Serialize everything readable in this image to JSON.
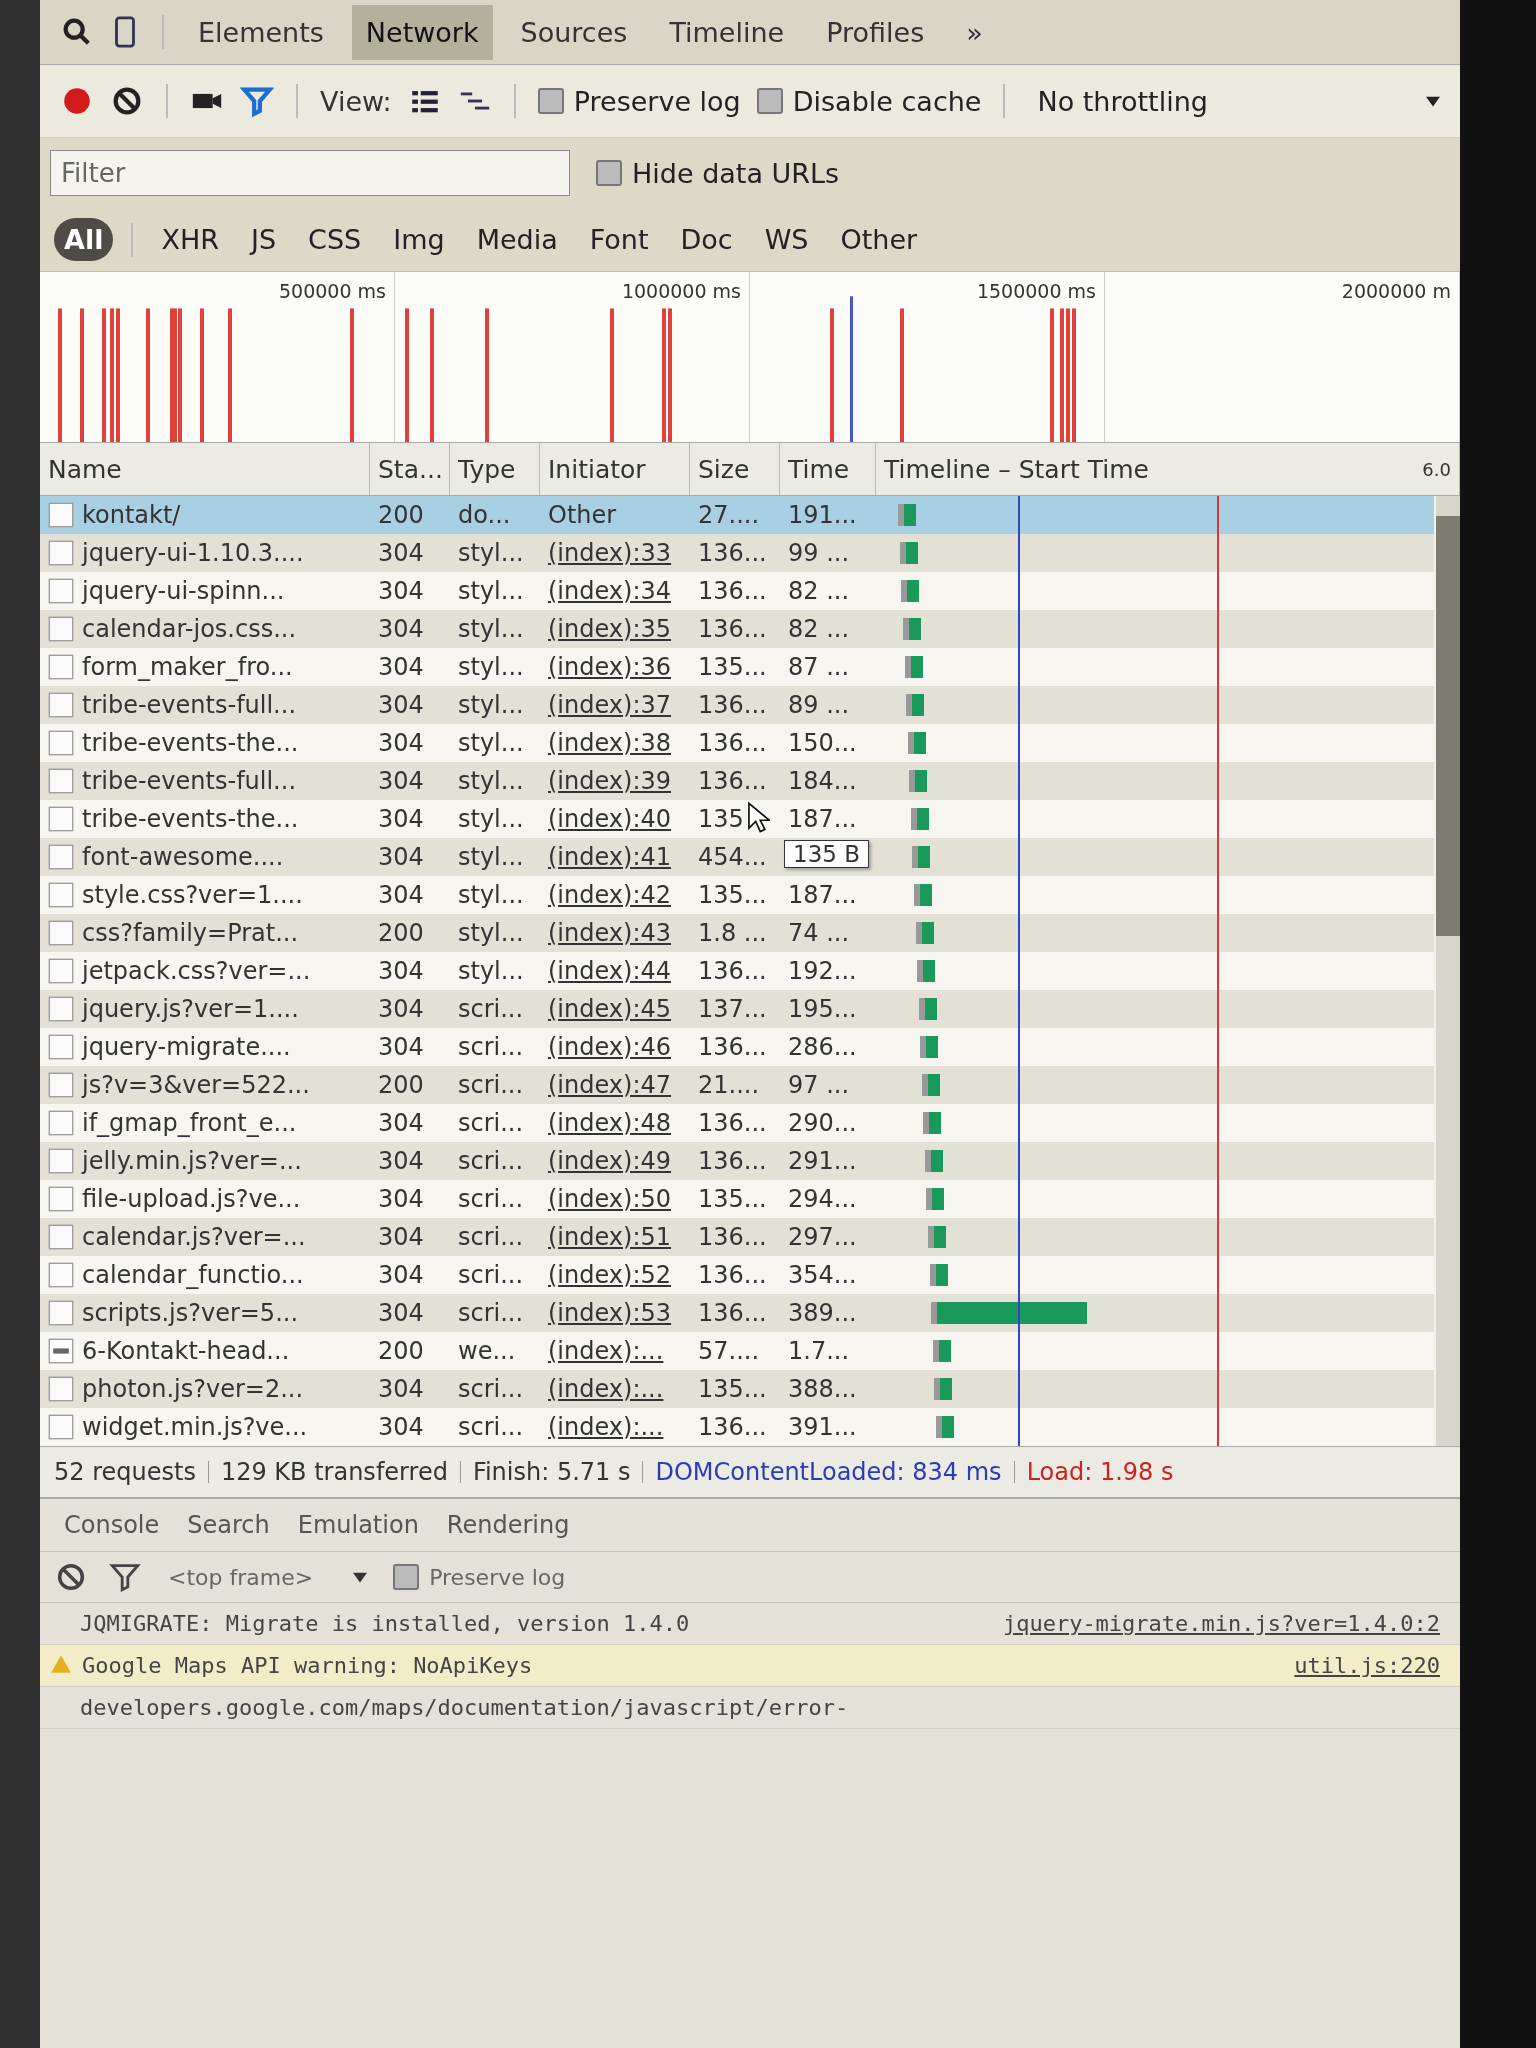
{
  "panel_tabs": [
    {
      "label": "Elements",
      "selected": false
    },
    {
      "label": "Network",
      "selected": true
    },
    {
      "label": "Sources",
      "selected": false
    },
    {
      "label": "Timeline",
      "selected": false
    },
    {
      "label": "Profiles",
      "selected": false
    }
  ],
  "more_tabs": "»",
  "toolbar": {
    "recording": true,
    "filter_active": true,
    "view_label": "View:",
    "preserve_log": {
      "label": "Preserve log",
      "checked": false
    },
    "disable_cache": {
      "label": "Disable cache",
      "checked": false
    },
    "throttling": "No throttling"
  },
  "filter": {
    "placeholder": "Filter",
    "hide_data_urls": {
      "label": "Hide data URLs",
      "checked": false
    }
  },
  "type_filters": [
    {
      "label": "All",
      "selected": true
    },
    {
      "label": "XHR",
      "selected": false
    },
    {
      "label": "JS",
      "selected": false
    },
    {
      "label": "CSS",
      "selected": false
    },
    {
      "label": "Img",
      "selected": false
    },
    {
      "label": "Media",
      "selected": false
    },
    {
      "label": "Font",
      "selected": false
    },
    {
      "label": "Doc",
      "selected": false
    },
    {
      "label": "WS",
      "selected": false
    },
    {
      "label": "Other",
      "selected": false
    }
  ],
  "overview": {
    "ticks": [
      "500000 ms",
      "1000000 ms",
      "1500000 ms",
      "2000000 m"
    ]
  },
  "table": {
    "columns": [
      "Name",
      "Sta...",
      "Type",
      "Initiator",
      "Size",
      "Time",
      "Timeline – Start Time"
    ],
    "scale_label": "6.0",
    "rows": [
      {
        "name": "kontakt/",
        "status": "200",
        "type": "do...",
        "initiator": "Other",
        "linked": false,
        "size": "27....",
        "time": "191...",
        "selected": true,
        "thumbnail": false,
        "kind": "short"
      },
      {
        "name": "jquery-ui-1.10.3....",
        "status": "304",
        "type": "styl...",
        "initiator": "(index):33",
        "linked": true,
        "size": "136...",
        "time": "99 ...",
        "selected": false,
        "thumbnail": false,
        "kind": "short"
      },
      {
        "name": "jquery-ui-spinn...",
        "status": "304",
        "type": "styl...",
        "initiator": "(index):34",
        "linked": true,
        "size": "136...",
        "time": "82 ...",
        "selected": false,
        "thumbnail": false,
        "kind": "short"
      },
      {
        "name": "calendar-jos.css...",
        "status": "304",
        "type": "styl...",
        "initiator": "(index):35",
        "linked": true,
        "size": "136...",
        "time": "82 ...",
        "selected": false,
        "thumbnail": false,
        "kind": "short"
      },
      {
        "name": "form_maker_fro...",
        "status": "304",
        "type": "styl...",
        "initiator": "(index):36",
        "linked": true,
        "size": "135...",
        "time": "87 ...",
        "selected": false,
        "thumbnail": false,
        "kind": "short"
      },
      {
        "name": "tribe-events-full...",
        "status": "304",
        "type": "styl...",
        "initiator": "(index):37",
        "linked": true,
        "size": "136...",
        "time": "89 ...",
        "selected": false,
        "thumbnail": false,
        "kind": "short"
      },
      {
        "name": "tribe-events-the...",
        "status": "304",
        "type": "styl...",
        "initiator": "(index):38",
        "linked": true,
        "size": "136...",
        "time": "150...",
        "selected": false,
        "thumbnail": false,
        "kind": "short"
      },
      {
        "name": "tribe-events-full...",
        "status": "304",
        "type": "styl...",
        "initiator": "(index):39",
        "linked": true,
        "size": "136...",
        "time": "184...",
        "selected": false,
        "thumbnail": false,
        "kind": "short"
      },
      {
        "name": "tribe-events-the...",
        "status": "304",
        "type": "styl...",
        "initiator": "(index):40",
        "linked": true,
        "size": "135",
        "time": "187...",
        "selected": false,
        "thumbnail": false,
        "kind": "short"
      },
      {
        "name": "font-awesome....",
        "status": "304",
        "type": "styl...",
        "initiator": "(index):41",
        "linked": true,
        "size": "454...",
        "tooltip": "135 B",
        "selected": false,
        "thumbnail": false,
        "kind": "short"
      },
      {
        "name": "style.css?ver=1....",
        "status": "304",
        "type": "styl...",
        "initiator": "(index):42",
        "linked": true,
        "size": "135...",
        "time": "187...",
        "selected": false,
        "thumbnail": false,
        "kind": "short"
      },
      {
        "name": "css?family=Prat...",
        "status": "200",
        "type": "styl...",
        "initiator": "(index):43",
        "linked": true,
        "size": "1.8 ...",
        "time": "74 ...",
        "selected": false,
        "thumbnail": false,
        "kind": "short"
      },
      {
        "name": "jetpack.css?ver=...",
        "status": "304",
        "type": "styl...",
        "initiator": "(index):44",
        "linked": true,
        "size": "136...",
        "time": "192...",
        "selected": false,
        "thumbnail": false,
        "kind": "short"
      },
      {
        "name": "jquery.js?ver=1....",
        "status": "304",
        "type": "scri...",
        "initiator": "(index):45",
        "linked": true,
        "size": "137...",
        "time": "195...",
        "selected": false,
        "thumbnail": false,
        "kind": "short"
      },
      {
        "name": "jquery-migrate....",
        "status": "304",
        "type": "scri...",
        "initiator": "(index):46",
        "linked": true,
        "size": "136...",
        "time": "286...",
        "selected": false,
        "thumbnail": false,
        "kind": "short"
      },
      {
        "name": "js?v=3&ver=522...",
        "status": "200",
        "type": "scri...",
        "initiator": "(index):47",
        "linked": true,
        "size": "21....",
        "time": "97 ...",
        "selected": false,
        "thumbnail": false,
        "kind": "short"
      },
      {
        "name": "if_gmap_front_e...",
        "status": "304",
        "type": "scri...",
        "initiator": "(index):48",
        "linked": true,
        "size": "136...",
        "time": "290...",
        "selected": false,
        "thumbnail": false,
        "kind": "short"
      },
      {
        "name": "jelly.min.js?ver=...",
        "status": "304",
        "type": "scri...",
        "initiator": "(index):49",
        "linked": true,
        "size": "136...",
        "time": "291...",
        "selected": false,
        "thumbnail": false,
        "kind": "short"
      },
      {
        "name": "file-upload.js?ve...",
        "status": "304",
        "type": "scri...",
        "initiator": "(index):50",
        "linked": true,
        "size": "135...",
        "time": "294...",
        "selected": false,
        "thumbnail": false,
        "kind": "short"
      },
      {
        "name": "calendar.js?ver=...",
        "status": "304",
        "type": "scri...",
        "initiator": "(index):51",
        "linked": true,
        "size": "136...",
        "time": "297...",
        "selected": false,
        "thumbnail": false,
        "kind": "short"
      },
      {
        "name": "calendar_functio...",
        "status": "304",
        "type": "scri...",
        "initiator": "(index):52",
        "linked": true,
        "size": "136...",
        "time": "354...",
        "selected": false,
        "thumbnail": false,
        "kind": "short"
      },
      {
        "name": "scripts.js?ver=5...",
        "status": "304",
        "type": "scri...",
        "initiator": "(index):53",
        "linked": true,
        "size": "136...",
        "time": "389...",
        "selected": false,
        "thumbnail": false,
        "kind": "long"
      },
      {
        "name": "6-Kontakt-head...",
        "status": "200",
        "type": "we...",
        "initiator": "(index):...",
        "linked": true,
        "size": "57....",
        "time": "1.7...",
        "selected": false,
        "thumbnail": true,
        "kind": "short"
      },
      {
        "name": "photon.js?ver=2...",
        "status": "304",
        "type": "scri...",
        "initiator": "(index):...",
        "linked": true,
        "size": "135...",
        "time": "388...",
        "selected": false,
        "thumbnail": false,
        "kind": "short"
      },
      {
        "name": "widget.min.js?ve...",
        "status": "304",
        "type": "scri...",
        "initiator": "(index):...",
        "linked": true,
        "size": "136...",
        "time": "391...",
        "selected": false,
        "thumbnail": false,
        "kind": "short"
      }
    ]
  },
  "summary": [
    {
      "text": "52 requests",
      "kind": "plain"
    },
    {
      "text": "129 KB transferred",
      "kind": "plain"
    },
    {
      "text": "Finish: 5.71 s",
      "kind": "plain"
    },
    {
      "text": "DOMContentLoaded: 834 ms",
      "kind": "dom"
    },
    {
      "text": "Load: 1.98 s",
      "kind": "load"
    }
  ],
  "drawer_tabs": [
    "Console",
    "Search",
    "Emulation",
    "Rendering"
  ],
  "console": {
    "context": "<top frame>",
    "preserve_log": {
      "label": "Preserve log",
      "checked": false
    },
    "messages": [
      {
        "kind": "log",
        "text": "JQMIGRATE: Migrate is installed, version 1.4.0",
        "source": "jquery-migrate.min.js?ver=1.4.0:2"
      },
      {
        "kind": "warning",
        "text": "Google Maps API warning: NoApiKeys",
        "source": "util.js:220"
      },
      {
        "kind": "log",
        "text": "developers.google.com/maps/documentation/javascript/error-"
      }
    ]
  }
}
